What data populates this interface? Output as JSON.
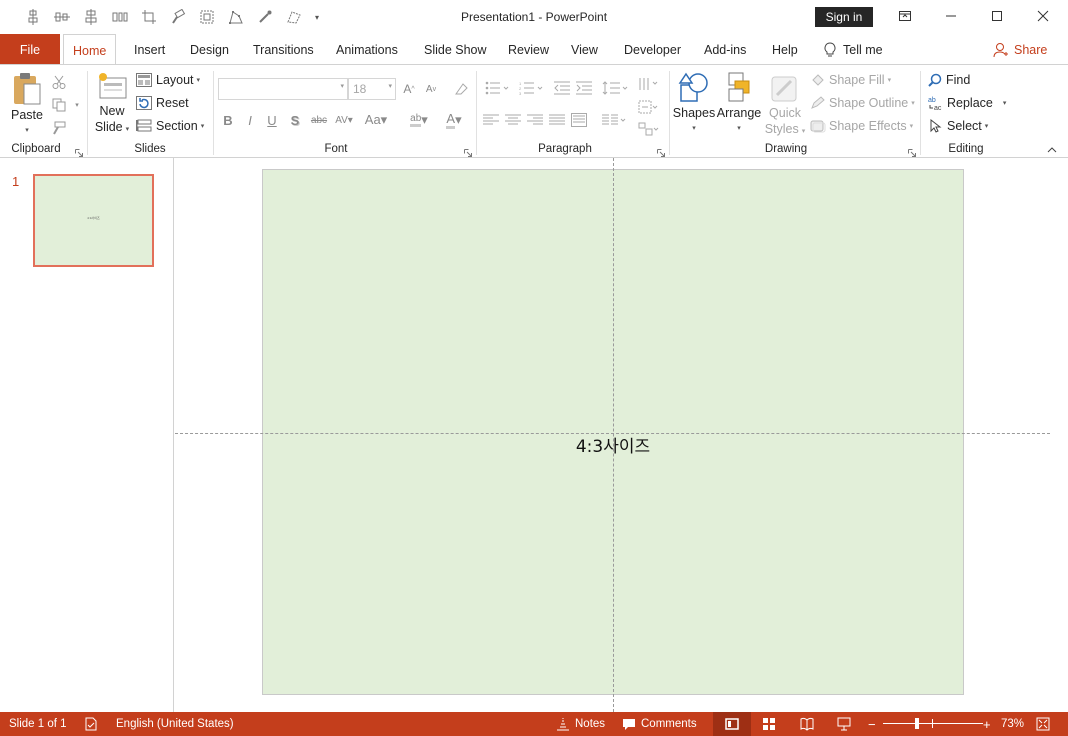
{
  "titlebar": {
    "title": "Presentation1  -  PowerPoint",
    "sign_in": "Sign in"
  },
  "tabs": {
    "file": "File",
    "items": [
      "Home",
      "Insert",
      "Design",
      "Transitions",
      "Animations",
      "Slide Show",
      "Review",
      "View",
      "Developer",
      "Add-ins",
      "Help"
    ],
    "tell_me": "Tell me",
    "share": "Share"
  },
  "ribbon": {
    "clipboard": {
      "paste": "Paste",
      "label": "Clipboard"
    },
    "slides": {
      "new_slide_1": "New",
      "new_slide_2": "Slide",
      "layout": "Layout",
      "reset": "Reset",
      "section": "Section",
      "label": "Slides"
    },
    "font": {
      "font_name": "",
      "font_size": "18",
      "label": "Font",
      "bold": "B",
      "italic": "I",
      "underline": "U",
      "shadow": "S",
      "strike": "abc"
    },
    "paragraph": {
      "label": "Paragraph"
    },
    "drawing": {
      "shapes": "Shapes",
      "arrange": "Arrange",
      "quick_1": "Quick",
      "quick_2": "Styles",
      "shape_fill": "Shape Fill",
      "shape_outline": "Shape Outline",
      "shape_effects": "Shape Effects",
      "label": "Drawing"
    },
    "editing": {
      "find": "Find",
      "replace": "Replace",
      "select": "Select",
      "label": "Editing"
    }
  },
  "thumbnails": {
    "slide_number": "1"
  },
  "slide": {
    "text": "4:3사이즈"
  },
  "statusbar": {
    "slide_info": "Slide 1 of 1",
    "language": "English (United States)",
    "notes": "Notes",
    "comments": "Comments",
    "zoom": "73%",
    "zoom_level": 0.73
  },
  "colors": {
    "accent": "#c43e1c",
    "slide_bg": "#e2efd9",
    "thumb_border": "#e2705a"
  }
}
